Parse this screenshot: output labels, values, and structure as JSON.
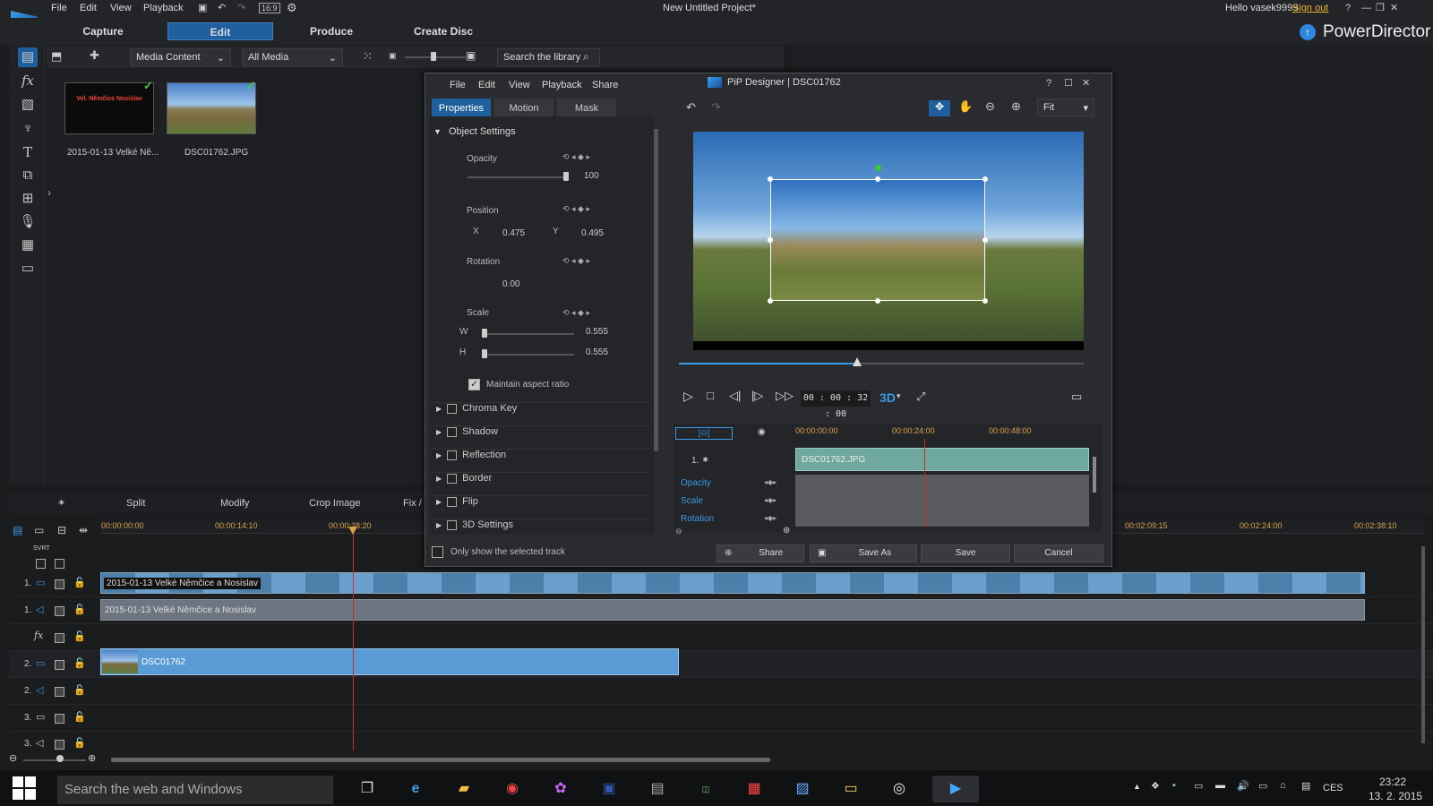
{
  "window": {
    "title": "New Untitled Project*",
    "greeting": "Hello vasek9999",
    "signout": "Sign out",
    "brand": "PowerDirector"
  },
  "menu": [
    "File",
    "Edit",
    "View",
    "Playback"
  ],
  "modes": {
    "capture": "Capture",
    "edit": "Edit",
    "produce": "Produce",
    "create_disc": "Create Disc"
  },
  "library": {
    "media_content": "Media Content",
    "all_media": "All Media",
    "search_placeholder": "Search the library",
    "items": [
      {
        "caption": "2015-01-13 Velké Ně...",
        "thumb_text": "Vel. Němčice Nosislav"
      },
      {
        "caption": "DSC01762.JPG"
      }
    ]
  },
  "editbar": {
    "split": "Split",
    "modify": "Modify",
    "crop": "Crop Image",
    "fix": "Fix /"
  },
  "ruler": {
    "labels": [
      "00:00:00:00",
      "00:00:14:10",
      "00:00:28:20",
      "00:02:09:15",
      "00:02:24:00",
      "00:02:38:10"
    ]
  },
  "tracks": {
    "header_label": "SVRT",
    "video1_clip": "2015-01-13 Velké Němčice a Nosislav",
    "audio1_clip": "2015-01-13 Velké Němčice a Nosislav",
    "video2_clip": "DSC01762",
    "row_labels": [
      "1.",
      "1.",
      "",
      "2.",
      "2.",
      "3.",
      "3."
    ]
  },
  "dialog": {
    "title": "PiP Designer | DSC01762",
    "menu": [
      "File",
      "Edit",
      "View",
      "Playback",
      "Share"
    ],
    "tabs": {
      "properties": "Properties",
      "motion": "Motion",
      "mask": "Mask"
    },
    "object_settings": "Object Settings",
    "opacity": {
      "label": "Opacity",
      "value": "100",
      "level": 1.0
    },
    "position": {
      "label": "Position",
      "x_label": "X",
      "x": "0.475",
      "y_label": "Y",
      "y": "0.495"
    },
    "rotation": {
      "label": "Rotation",
      "value": "0.00"
    },
    "scale": {
      "label": "Scale",
      "w_label": "W",
      "w": "0.555",
      "h_label": "H",
      "h": "0.555"
    },
    "maintain_aspect": "Maintain aspect ratio",
    "sections": [
      "Chroma Key",
      "Shadow",
      "Reflection",
      "Border",
      "Flip",
      "3D Settings"
    ],
    "only_selected": "Only show the selected track",
    "fit": "Fit",
    "timecode": "00 : 00 : 32 : 00",
    "threed": "3D",
    "playback_progress": 0.44,
    "kf_ruler": [
      "00:00:00:00",
      "00:00:24:00",
      "00:00:48:00"
    ],
    "kf_track_label": "1.",
    "kf_clip": "DSC01762.JPG",
    "kf_rows": [
      "Opacity",
      "Scale",
      "Rotation"
    ],
    "buttons": {
      "share": "Share",
      "save_as": "Save As",
      "save": "Save",
      "cancel": "Cancel"
    }
  },
  "taskbar": {
    "search": "Search the web and Windows",
    "lang": "CES",
    "time": "23:22",
    "date": "13. 2. 2015"
  },
  "colors": {
    "accent": "#1f5f9e",
    "playhead": "#c92a2a",
    "clip_video": "#5b9bd5",
    "clip_pip": "#6fa89c"
  }
}
